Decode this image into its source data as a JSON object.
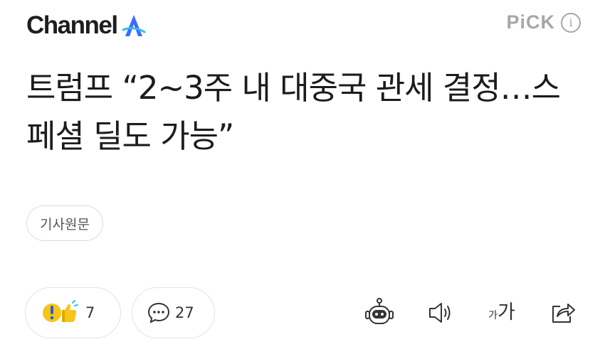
{
  "header": {
    "brand": "Channel",
    "brand_mark": "A",
    "brand_mark_color": "#3d6bff",
    "pick_label": "PiCK",
    "info_label": "i"
  },
  "article": {
    "headline": "트럼프 “2~3주 내 대중국 관세 결정…스페셜 딜도 가능”",
    "source_button": "기사원문"
  },
  "actions": {
    "reaction_count": "7",
    "comment_count": "27",
    "font_size_small": "가",
    "font_size_large": "가",
    "icons": [
      "reaction-icon",
      "comment-icon",
      "ai-bot-icon",
      "speaker-icon",
      "font-size-icon",
      "share-icon"
    ]
  }
}
